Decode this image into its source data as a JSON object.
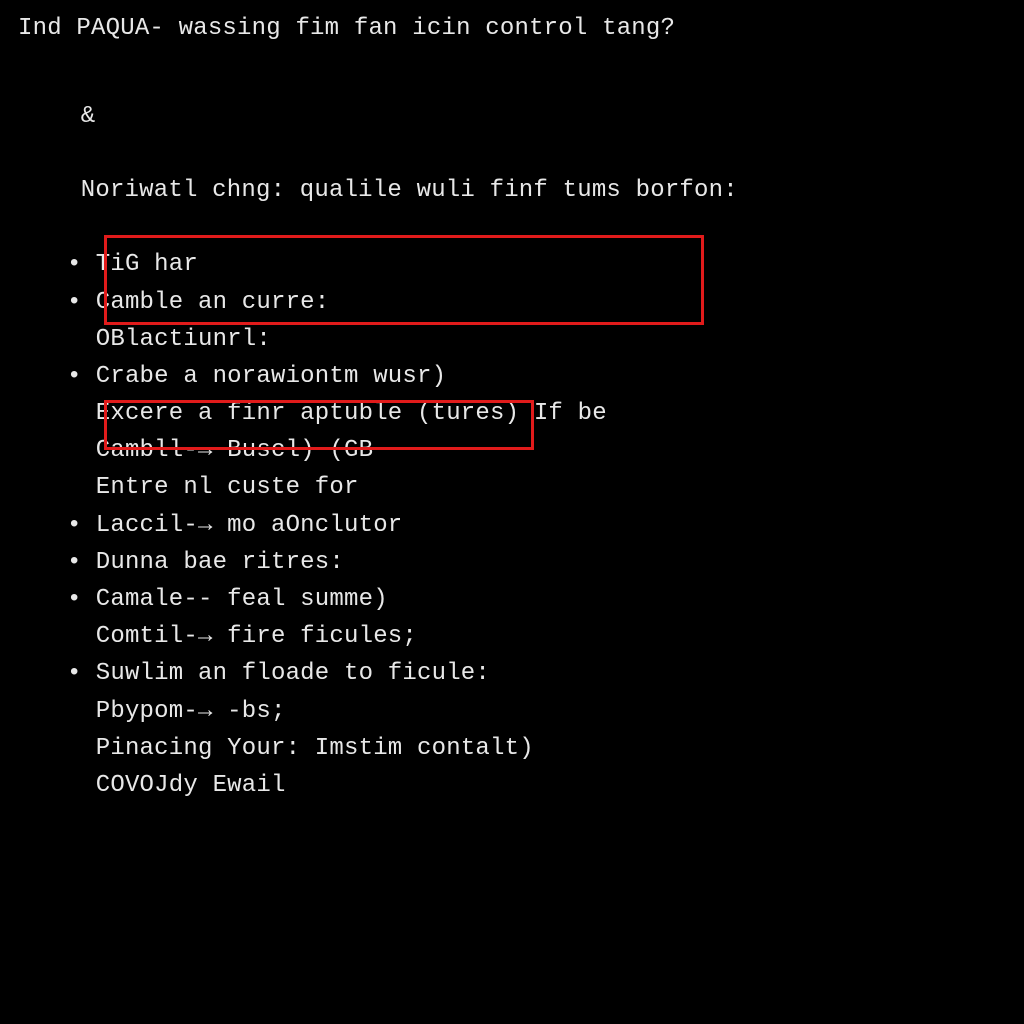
{
  "title_line": "Ind PAQUA- wassing fim fan icin control tang?",
  "heading_marker": "&",
  "heading": "Noriwatl chng: qualile wuli finf tums borfon:",
  "bullet_char": "•",
  "items": [
    {
      "bullet": true,
      "text": "TiG har"
    },
    {
      "bullet": true,
      "text": "Camble an curre:"
    },
    {
      "bullet": false,
      "text": "OBlactiunrl:"
    },
    {
      "bullet": true,
      "text": "Crabe a norawiontm wusr)"
    },
    {
      "bullet": false,
      "text": "Excere a finr aptuble (tures) If be"
    },
    {
      "bullet": false,
      "text": "Cambll-→ Buscl) (GB"
    },
    {
      "bullet": false,
      "text": "Entre nl custe for"
    },
    {
      "bullet": true,
      "text": "Laccil-→ mo aOnclutor"
    },
    {
      "bullet": true,
      "text": "Dunna bae ritres:"
    },
    {
      "bullet": true,
      "text": "Camale-- feal summe)"
    },
    {
      "bullet": false,
      "text": "Comtil-→ fire ficules;"
    },
    {
      "bullet": true,
      "text": "Suwlim an floade to ficule:"
    },
    {
      "bullet": false,
      "text": "Pbypom-→ -bs;"
    },
    {
      "bullet": false,
      "text": "Pinacing Your: Imstim contalt)"
    },
    {
      "bullet": false,
      "text": "COVOJdy Ewail"
    }
  ],
  "highlights": {
    "box1_desc": "highlight-lines-4-5",
    "box2_desc": "highlight-line-8"
  }
}
